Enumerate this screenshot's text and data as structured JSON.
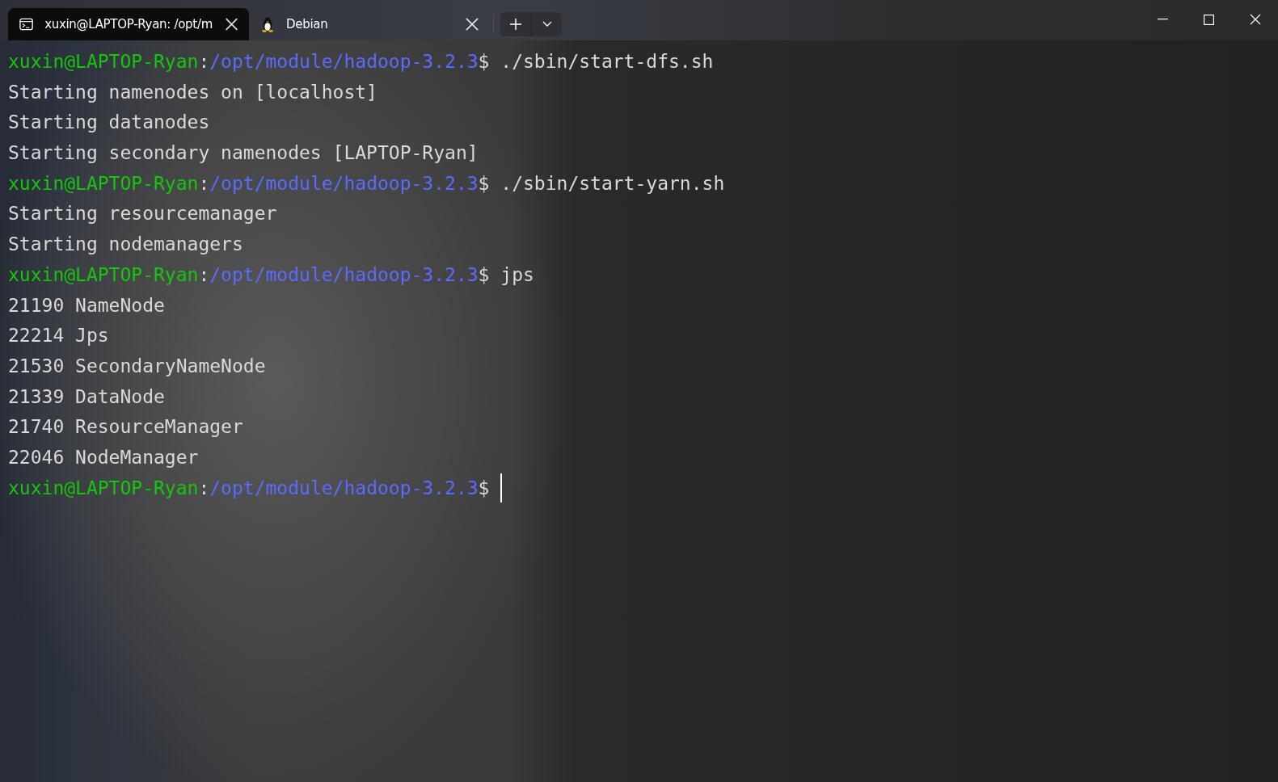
{
  "tabs": [
    {
      "title": "xuxin@LAPTOP-Ryan: /opt/m",
      "selected": true
    },
    {
      "title": "Debian",
      "selected": false
    }
  ],
  "terminal": {
    "lines": [
      {
        "kind": "prompt",
        "user_host": "xuxin@LAPTOP-Ryan",
        "separator": ":",
        "path": "/opt/module/hadoop-3.2.3",
        "symbol": "$",
        "command": "./sbin/start-dfs.sh"
      },
      {
        "kind": "output",
        "text": "Starting namenodes on [localhost]"
      },
      {
        "kind": "output",
        "text": "Starting datanodes"
      },
      {
        "kind": "output",
        "text": "Starting secondary namenodes [LAPTOP-Ryan]"
      },
      {
        "kind": "prompt",
        "user_host": "xuxin@LAPTOP-Ryan",
        "separator": ":",
        "path": "/opt/module/hadoop-3.2.3",
        "symbol": "$",
        "command": "./sbin/start-yarn.sh"
      },
      {
        "kind": "output",
        "text": "Starting resourcemanager"
      },
      {
        "kind": "output",
        "text": "Starting nodemanagers"
      },
      {
        "kind": "prompt",
        "user_host": "xuxin@LAPTOP-Ryan",
        "separator": ":",
        "path": "/opt/module/hadoop-3.2.3",
        "symbol": "$",
        "command": "jps"
      },
      {
        "kind": "output",
        "text": "21190 NameNode"
      },
      {
        "kind": "output",
        "text": "22214 Jps"
      },
      {
        "kind": "output",
        "text": "21530 SecondaryNameNode"
      },
      {
        "kind": "output",
        "text": "21339 DataNode"
      },
      {
        "kind": "output",
        "text": "21740 ResourceManager"
      },
      {
        "kind": "output",
        "text": "22046 NodeManager"
      },
      {
        "kind": "prompt",
        "user_host": "xuxin@LAPTOP-Ryan",
        "separator": ":",
        "path": "/opt/module/hadoop-3.2.3",
        "symbol": "$",
        "cursor": true
      }
    ]
  }
}
